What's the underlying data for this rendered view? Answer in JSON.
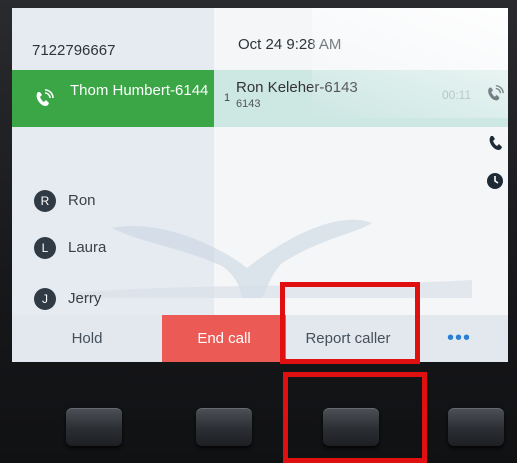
{
  "phone_number": "7122796667",
  "datetime": "Oct 24 9:28 AM",
  "active_line": {
    "name": "Thom Humbert-6144"
  },
  "call": {
    "index": "1",
    "name": "Ron Keleher-6143",
    "extension": "6143",
    "timer": "00:11"
  },
  "contacts": [
    {
      "initial": "R",
      "name": "Ron"
    },
    {
      "initial": "L",
      "name": "Laura"
    },
    {
      "initial": "J",
      "name": "Jerry"
    }
  ],
  "softkeys": {
    "hold": "Hold",
    "end_call": "End call",
    "report_caller": "Report caller",
    "more": "•••"
  },
  "colors": {
    "active_line": "#3aa646",
    "end_call": "#ec5a56",
    "highlight": "#e00f10",
    "more_dots": "#2a7fd4"
  },
  "icons": [
    "handset-ring-icon",
    "phone-icon",
    "clock-icon"
  ]
}
